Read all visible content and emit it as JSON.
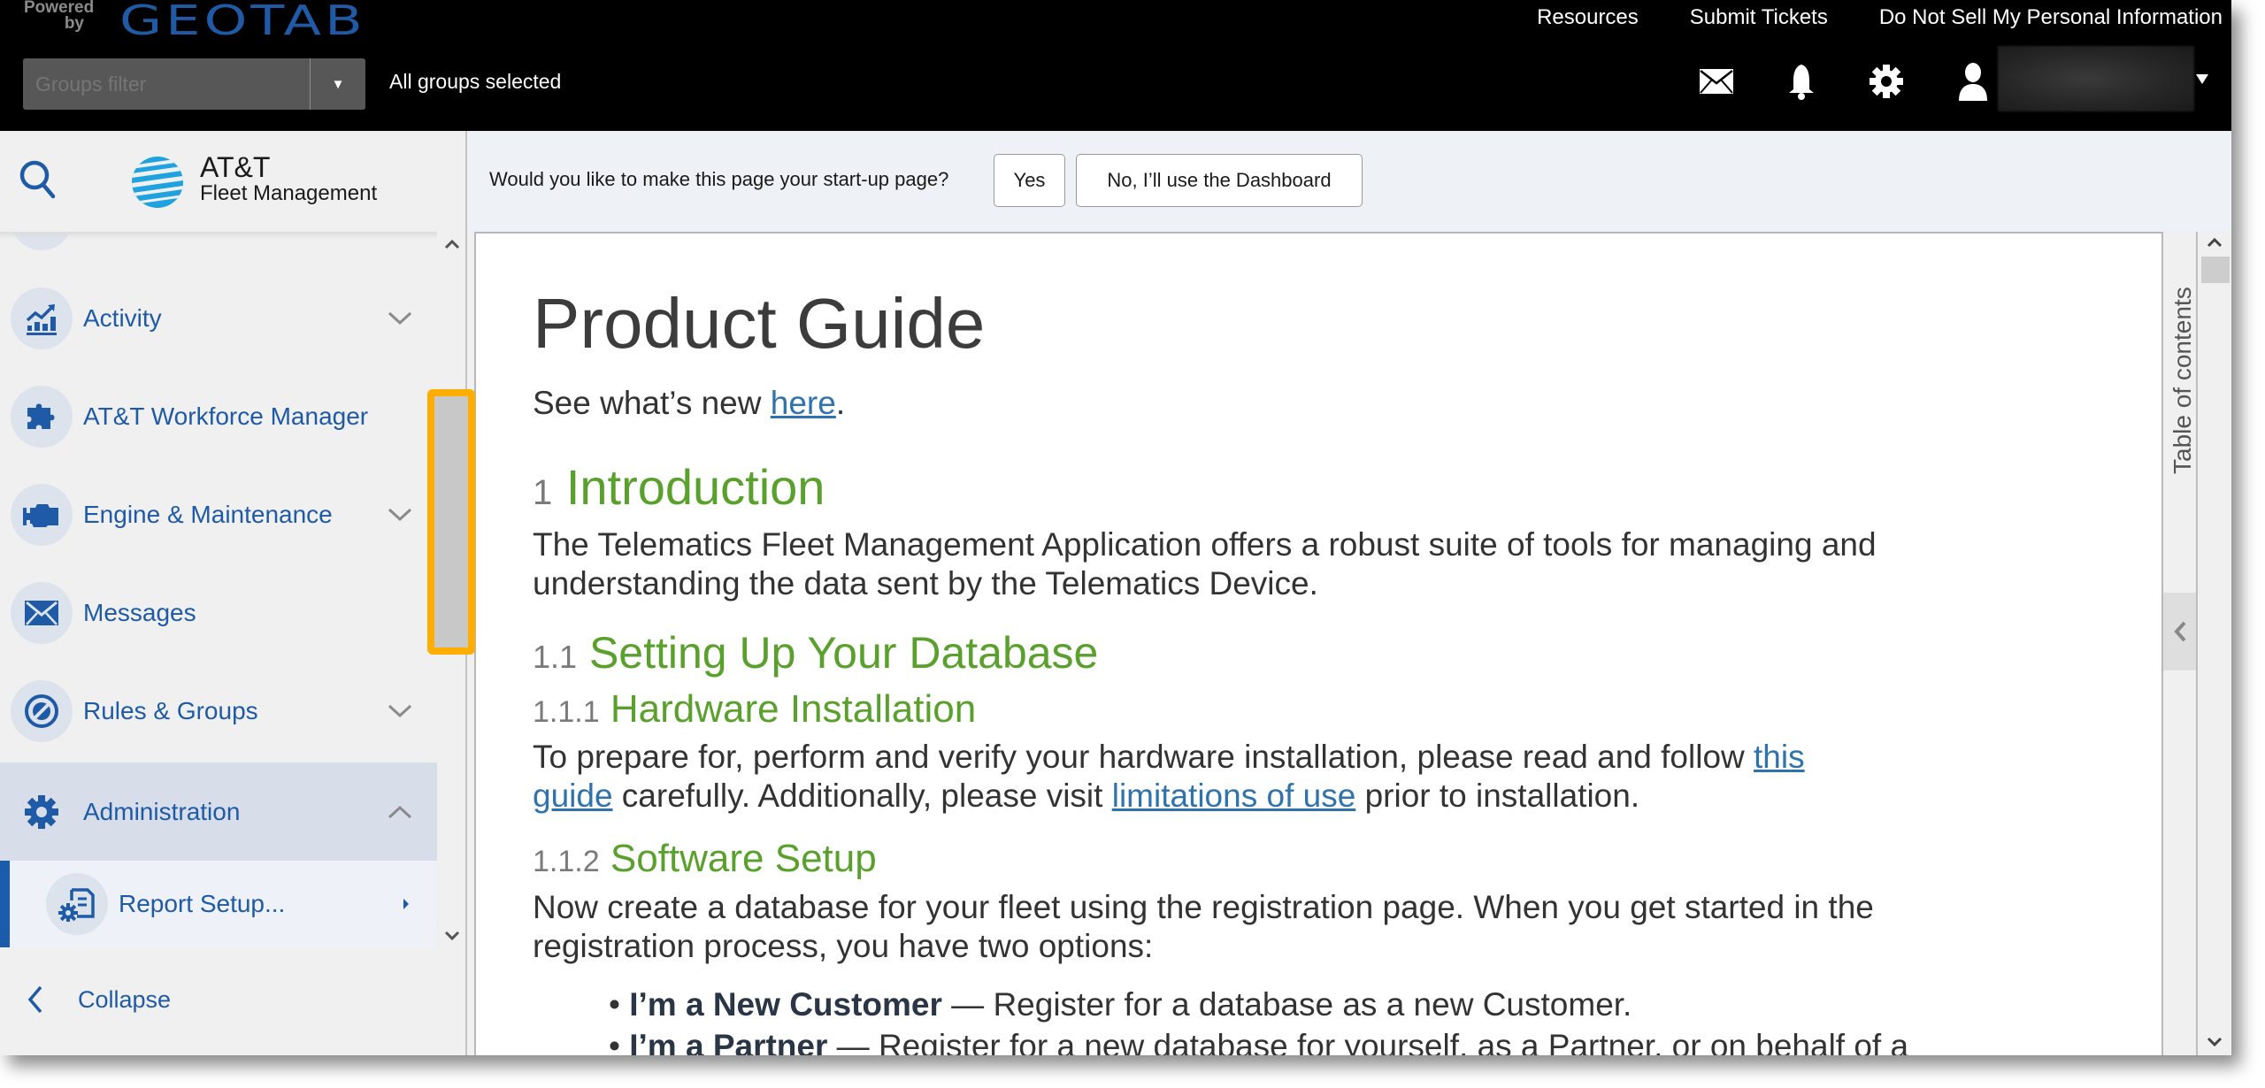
{
  "header": {
    "powered_by": "Powered by",
    "brand": "GEOTAB",
    "links": [
      "Resources",
      "Submit Tickets",
      "Do Not Sell My Personal Information"
    ],
    "groups_filter": {
      "placeholder": "Groups filter",
      "value": ""
    },
    "groups_status": "All groups selected",
    "icons": [
      "mail-icon",
      "bell-icon",
      "gear-icon",
      "user-icon"
    ]
  },
  "sidebar": {
    "logo": {
      "line1": "AT&T",
      "line2": "Fleet Management"
    },
    "items": [
      {
        "label": "Activity",
        "icon": "activity-chart-icon",
        "expandable": true,
        "expanded": false
      },
      {
        "label": "AT&T Workforce Manager",
        "icon": "puzzle-icon",
        "expandable": false
      },
      {
        "label": "Engine & Maintenance",
        "icon": "engine-icon",
        "expandable": true,
        "expanded": false
      },
      {
        "label": "Messages",
        "icon": "envelope-icon",
        "expandable": false
      },
      {
        "label": "Rules & Groups",
        "icon": "rules-icon",
        "expandable": true,
        "expanded": false
      },
      {
        "label": "Administration",
        "icon": "gear-icon",
        "expandable": true,
        "expanded": true,
        "active": true
      }
    ],
    "subitems": [
      {
        "label": "Report Setup...",
        "icon": "report-setup-icon",
        "has_submenu": true
      }
    ],
    "collapse_label": "Collapse"
  },
  "banner": {
    "question": "Would you like to make this page your start-up page?",
    "yes_label": "Yes",
    "no_label": "No, I’ll use the Dashboard"
  },
  "document": {
    "title": "Product Guide",
    "whats_new_prefix": "See what’s new ",
    "whats_new_link": "here",
    "whats_new_suffix": ".",
    "sections": [
      {
        "num": "1",
        "title": "Introduction",
        "body_line1": "The Telematics Fleet Management Application offers a robust suite of tools for managing and",
        "body_line2": "understanding the data sent by the Telematics Device."
      },
      {
        "num": "1.1",
        "title": "Setting Up Your Database"
      },
      {
        "num": "1.1.1",
        "title": "Hardware Installation",
        "line1_prefix": "To prepare for, perform and verify your hardware installation, please read and follow ",
        "line1_link": "this",
        "line2_link": "guide",
        "line2_mid": " carefully. Additionally, please visit ",
        "line2_link2": "limitations of use",
        "line2_suffix": " prior to installation."
      },
      {
        "num": "1.1.2",
        "title": "Software Setup",
        "body_line1": "Now create a database for your fleet using the registration page. When you get started in the",
        "body_line2": "registration process, you have two options:"
      }
    ],
    "options": [
      {
        "bold": "I’m a New Customer",
        "text": " — Register for a database as a new Customer."
      },
      {
        "bold": "I’m a Partner",
        "text": " — Register for a new database for yourself, as a Partner, or on behalf of a"
      }
    ]
  },
  "toc": {
    "label": "Table of contents"
  },
  "colors": {
    "brand_blue": "#1f5aa6",
    "heading_green": "#5aa02c",
    "link_blue": "#2f73ad",
    "highlight_orange": "#ffae00",
    "header_bg": "#000000"
  }
}
